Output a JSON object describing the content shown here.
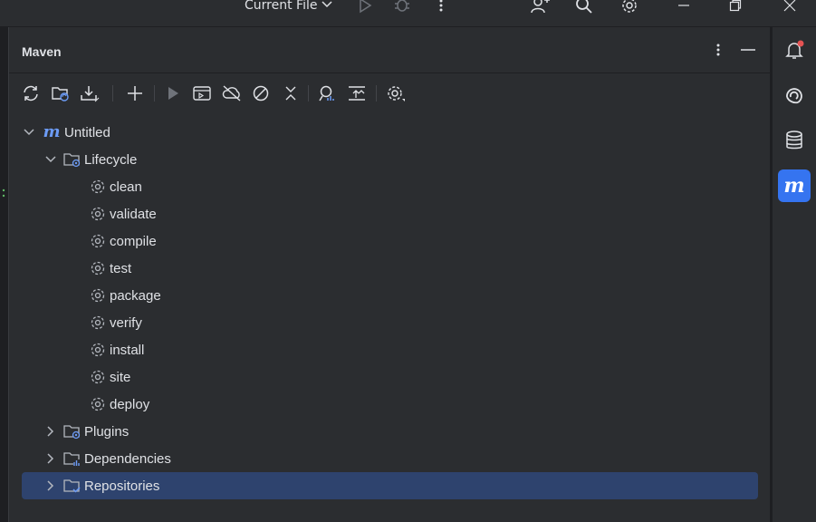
{
  "titlebar": {
    "run_config": "Current File"
  },
  "panel": {
    "title": "Maven"
  },
  "tree": {
    "root": {
      "label": "Untitled"
    },
    "lifecycle": {
      "label": "Lifecycle",
      "goals": [
        "clean",
        "validate",
        "compile",
        "test",
        "package",
        "verify",
        "install",
        "site",
        "deploy"
      ]
    },
    "plugins": {
      "label": "Plugins"
    },
    "dependencies": {
      "label": "Dependencies"
    },
    "repositories": {
      "label": "Repositories"
    }
  },
  "colors": {
    "background": "#2b2d30",
    "selection": "#2e436e",
    "accent": "#3574f0",
    "maven_icon": "#6c9bf5",
    "notification_badge": "#e55353"
  },
  "right_strip": {
    "icons": [
      "notifications-icon",
      "ai-assistant-icon",
      "database-icon",
      "maven-icon"
    ]
  }
}
